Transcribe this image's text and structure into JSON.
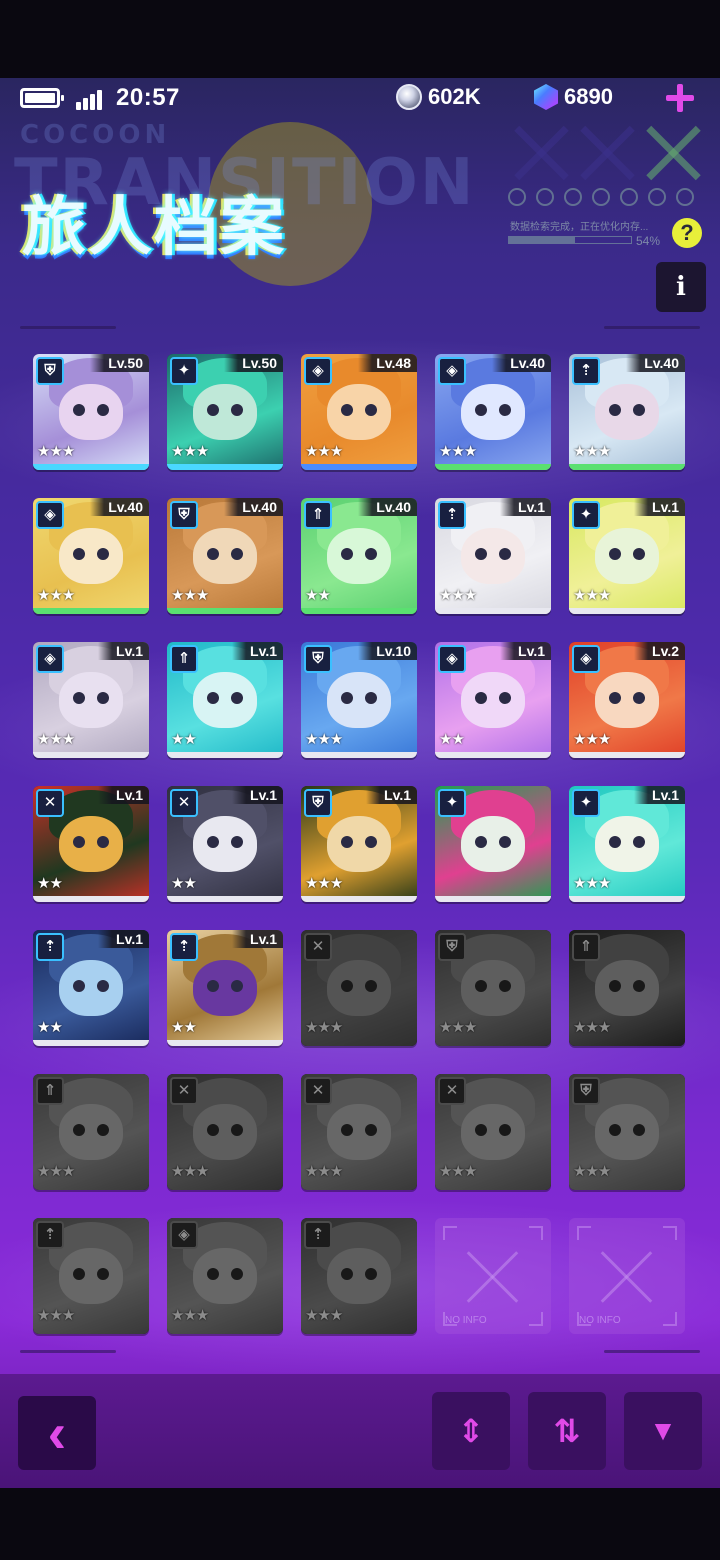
{
  "status": {
    "time": "20:57",
    "coins": "602K",
    "gems": "6890"
  },
  "header": {
    "title": "旅人档案",
    "bg_brand": "COCOON",
    "bg_word": "TRANSITION",
    "loading_text": "数据检索完成，正在优化内存...",
    "loading_percent": "54%",
    "loading_progress": 0.54,
    "help": "?",
    "info": "i"
  },
  "roster": [
    {
      "level": "Lv.50",
      "role": "shield-icon",
      "stars": "★★★",
      "palette": [
        "#d8e0f8",
        "#a58fd8",
        "#e8d4f0"
      ],
      "bar": "#4ad8ff"
    },
    {
      "level": "Lv.50",
      "role": "bow-icon",
      "stars": "★★★",
      "palette": [
        "#1c6a6a",
        "#3cd0b0",
        "#bfe8d8"
      ],
      "bar": "#4ad8ff"
    },
    {
      "level": "Lv.48",
      "role": "diamond-icon",
      "stars": "★★★",
      "palette": [
        "#f0a040",
        "#e88a2c",
        "#f8d4a8"
      ],
      "bar": "#4a8cff"
    },
    {
      "level": "Lv.40",
      "role": "diamond-icon",
      "stars": "★★★",
      "palette": [
        "#8aa8f0",
        "#5a7ae0",
        "#e0e8ff"
      ],
      "bar": "#5ae070"
    },
    {
      "level": "Lv.40",
      "role": "arrow-icon",
      "stars": "★★★",
      "palette": [
        "#a8c0d8",
        "#d8e8f4",
        "#e8d8e8"
      ],
      "bar": "#5ae070"
    },
    {
      "level": "Lv.40",
      "role": "diamond-icon",
      "stars": "★★★",
      "palette": [
        "#f0d870",
        "#e8c050",
        "#f8e8c8"
      ],
      "bar": "#5ae070"
    },
    {
      "level": "Lv.40",
      "role": "shield-icon",
      "stars": "★★★",
      "palette": [
        "#b87838",
        "#d89858",
        "#f0d8b8"
      ],
      "bar": "#5ae070"
    },
    {
      "level": "Lv.40",
      "role": "arrow-up-icon",
      "stars": "★★",
      "palette": [
        "#5ad070",
        "#8ae890",
        "#d8f8d8"
      ],
      "bar": "#5ae070"
    },
    {
      "level": "Lv.1",
      "role": "arrow-icon",
      "stars": "★★★",
      "palette": [
        "#d8d8e0",
        "#f0f0f4",
        "#f4e8e8"
      ],
      "bar": "#e8e8f0"
    },
    {
      "level": "Lv.1",
      "role": "bow-icon",
      "stars": "★★★",
      "palette": [
        "#d8e860",
        "#f0f098",
        "#e8f4d8"
      ],
      "bar": "#e8e8f0"
    },
    {
      "level": "Lv.1",
      "role": "diamond-icon",
      "stars": "★★★",
      "palette": [
        "#b0a8c0",
        "#d8d0e0",
        "#e8e0f0"
      ],
      "bar": "#e8e8f0"
    },
    {
      "level": "Lv.1",
      "role": "arrow-up-icon",
      "stars": "★★",
      "palette": [
        "#20b8c8",
        "#58e0e0",
        "#d8f4f4"
      ],
      "bar": "#e8e8f0"
    },
    {
      "level": "Lv.10",
      "role": "shield-icon",
      "stars": "★★★",
      "palette": [
        "#3a78d8",
        "#68a8f0",
        "#d8e4f8"
      ],
      "bar": "#e8e8f0"
    },
    {
      "level": "Lv.1",
      "role": "diamond-icon",
      "stars": "★★",
      "palette": [
        "#b070e8",
        "#e8a0f0",
        "#f0d8f8"
      ],
      "bar": "#e8e8f0"
    },
    {
      "level": "Lv.2",
      "role": "diamond-icon",
      "stars": "★★★",
      "palette": [
        "#e04028",
        "#f07848",
        "#f8d8c0"
      ],
      "bar": "#e8e8f0"
    },
    {
      "level": "Lv.1",
      "role": "swords-icon",
      "stars": "★★",
      "palette": [
        "#c83028",
        "#203820",
        "#e8b048"
      ],
      "bar": "#e8e8f0"
    },
    {
      "level": "Lv.1",
      "role": "swords-icon",
      "stars": "★★",
      "palette": [
        "#303040",
        "#505068",
        "#e8e8f0"
      ],
      "bar": "#e8e8f0"
    },
    {
      "level": "Lv.1",
      "role": "shield-icon",
      "stars": "★★★",
      "palette": [
        "#283818",
        "#e0a030",
        "#f0d8a8"
      ],
      "bar": "#e8e8f0"
    },
    {
      "level": "",
      "role": "bow-icon",
      "stars": "",
      "palette": [
        "#20a050",
        "#e04090",
        "#e8f0e8"
      ],
      "bar": "#e8e8f0"
    },
    {
      "level": "Lv.1",
      "role": "bow-icon",
      "stars": "★★★",
      "palette": [
        "#20c8c0",
        "#60e8d8",
        "#f0f4e8"
      ],
      "bar": "#e8e8f0"
    },
    {
      "level": "Lv.1",
      "role": "arrow-icon",
      "stars": "★★",
      "palette": [
        "#18285a",
        "#3a5a9a",
        "#a8d0f0"
      ],
      "bar": "#e8e8f0"
    },
    {
      "level": "Lv.1",
      "role": "arrow-icon",
      "stars": "★★",
      "palette": [
        "#e8d0a0",
        "#a07838",
        "#6838a0"
      ],
      "bar": "#e8e8f0"
    },
    {
      "level": "",
      "role": "swords-icon",
      "stars": "★★★",
      "palette": [
        "#555",
        "#777",
        "#999"
      ],
      "locked": true
    },
    {
      "level": "",
      "role": "shield-icon",
      "stars": "★★★",
      "palette": [
        "#555",
        "#888",
        "#aaa"
      ],
      "locked": true
    },
    {
      "level": "",
      "role": "arrow-up-icon",
      "stars": "★★★",
      "palette": [
        "#333",
        "#777",
        "#aaa"
      ],
      "locked": true
    },
    {
      "level": "",
      "role": "arrow-up-icon",
      "stars": "★★★",
      "palette": [
        "#666",
        "#999",
        "#bbb"
      ],
      "locked": true
    },
    {
      "level": "",
      "role": "swords-icon",
      "stars": "★★★",
      "palette": [
        "#555",
        "#888",
        "#aaa"
      ],
      "locked": true
    },
    {
      "level": "",
      "role": "swords-icon",
      "stars": "★★★",
      "palette": [
        "#666",
        "#999",
        "#bbb"
      ],
      "locked": true
    },
    {
      "level": "",
      "role": "swords-icon",
      "stars": "★★★",
      "palette": [
        "#666",
        "#999",
        "#bbb"
      ],
      "locked": true
    },
    {
      "level": "",
      "role": "shield-icon",
      "stars": "★★★",
      "palette": [
        "#666",
        "#999",
        "#bbb"
      ],
      "locked": true
    },
    {
      "level": "",
      "role": "arrow-icon",
      "stars": "★★★",
      "palette": [
        "#666",
        "#999",
        "#bbb"
      ],
      "locked": true
    },
    {
      "level": "",
      "role": "diamond-icon",
      "stars": "★★★",
      "palette": [
        "#666",
        "#999",
        "#bbb"
      ],
      "locked": true
    },
    {
      "level": "",
      "role": "arrow-icon",
      "stars": "★★★",
      "palette": [
        "#555",
        "#888",
        "#aaa"
      ],
      "locked": true
    },
    {
      "empty": true,
      "label": "NO INFO"
    },
    {
      "empty": true,
      "label": "NO INFO"
    }
  ],
  "bottom_bar": {
    "back": "‹",
    "sort": "⇕",
    "swap": "⇅",
    "filter": "▼"
  },
  "colors": {
    "accent": "#e04ae8",
    "background": "#5a2ab8"
  }
}
